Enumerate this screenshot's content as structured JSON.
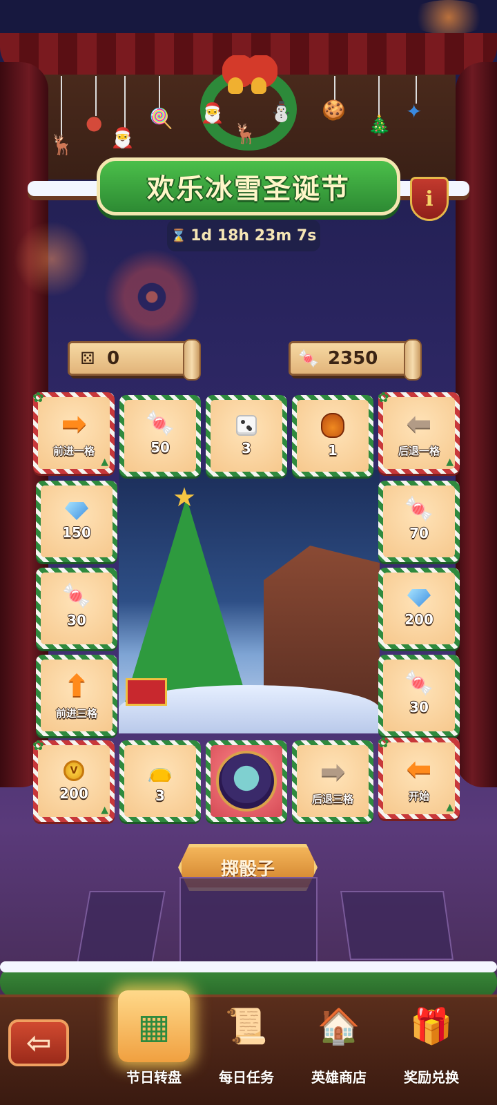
{
  "event": {
    "title": "欢乐冰雪圣诞节",
    "timer": "1d 18h 23m 7s",
    "info_icon": "info-icon"
  },
  "counters": {
    "dice": "0",
    "candy": "2350"
  },
  "board": {
    "top_row": [
      {
        "label": "前进一格",
        "icon": "arrow-right-icon",
        "style": "red"
      },
      {
        "label": "50",
        "icon": "candy-cane-icon",
        "style": "green"
      },
      {
        "label": "3",
        "icon": "dice-icon",
        "style": "green"
      },
      {
        "label": "1",
        "icon": "helmet-icon",
        "style": "green"
      },
      {
        "label": "后退一格",
        "icon": "arrow-left-icon",
        "style": "red"
      }
    ],
    "left_col": [
      {
        "label": "150",
        "icon": "gem-icon"
      },
      {
        "label": "30",
        "icon": "candy-cane-icon"
      },
      {
        "label": "前进三格",
        "icon": "arrow-up-icon"
      }
    ],
    "right_col": [
      {
        "label": "70",
        "icon": "candy-cane-icon"
      },
      {
        "label": "200",
        "icon": "gem-icon"
      },
      {
        "label": "30",
        "icon": "candy-cane-icon"
      }
    ],
    "bottom_row": [
      {
        "label": "200",
        "icon": "gold-coin-icon",
        "style": "red"
      },
      {
        "label": "3",
        "icon": "loot-bag-icon",
        "style": "green"
      },
      {
        "label": "",
        "icon": "hero-avatar-icon",
        "style": "green"
      },
      {
        "label": "后退三格",
        "icon": "arrow-right-icon",
        "style": "green"
      },
      {
        "label": "开始",
        "icon": "arrow-left-icon",
        "style": "red"
      }
    ],
    "coin_letter": "V"
  },
  "roll_button": "掷骰子",
  "nav": {
    "back_icon": "back-arrow-icon",
    "items": [
      {
        "label": "节日转盘",
        "icon": "festival-wheel-icon",
        "active": true
      },
      {
        "label": "每日任务",
        "icon": "scroll-task-icon",
        "active": false
      },
      {
        "label": "英雄商店",
        "icon": "shop-icon",
        "active": false
      },
      {
        "label": "奖励兑换",
        "icon": "gift-box-icon",
        "active": false
      }
    ]
  },
  "colors": {
    "accent_green": "#2f8a3e",
    "accent_red": "#c8383a",
    "tile_fill": "#f6c88d",
    "button_orange": "#d0802a"
  }
}
